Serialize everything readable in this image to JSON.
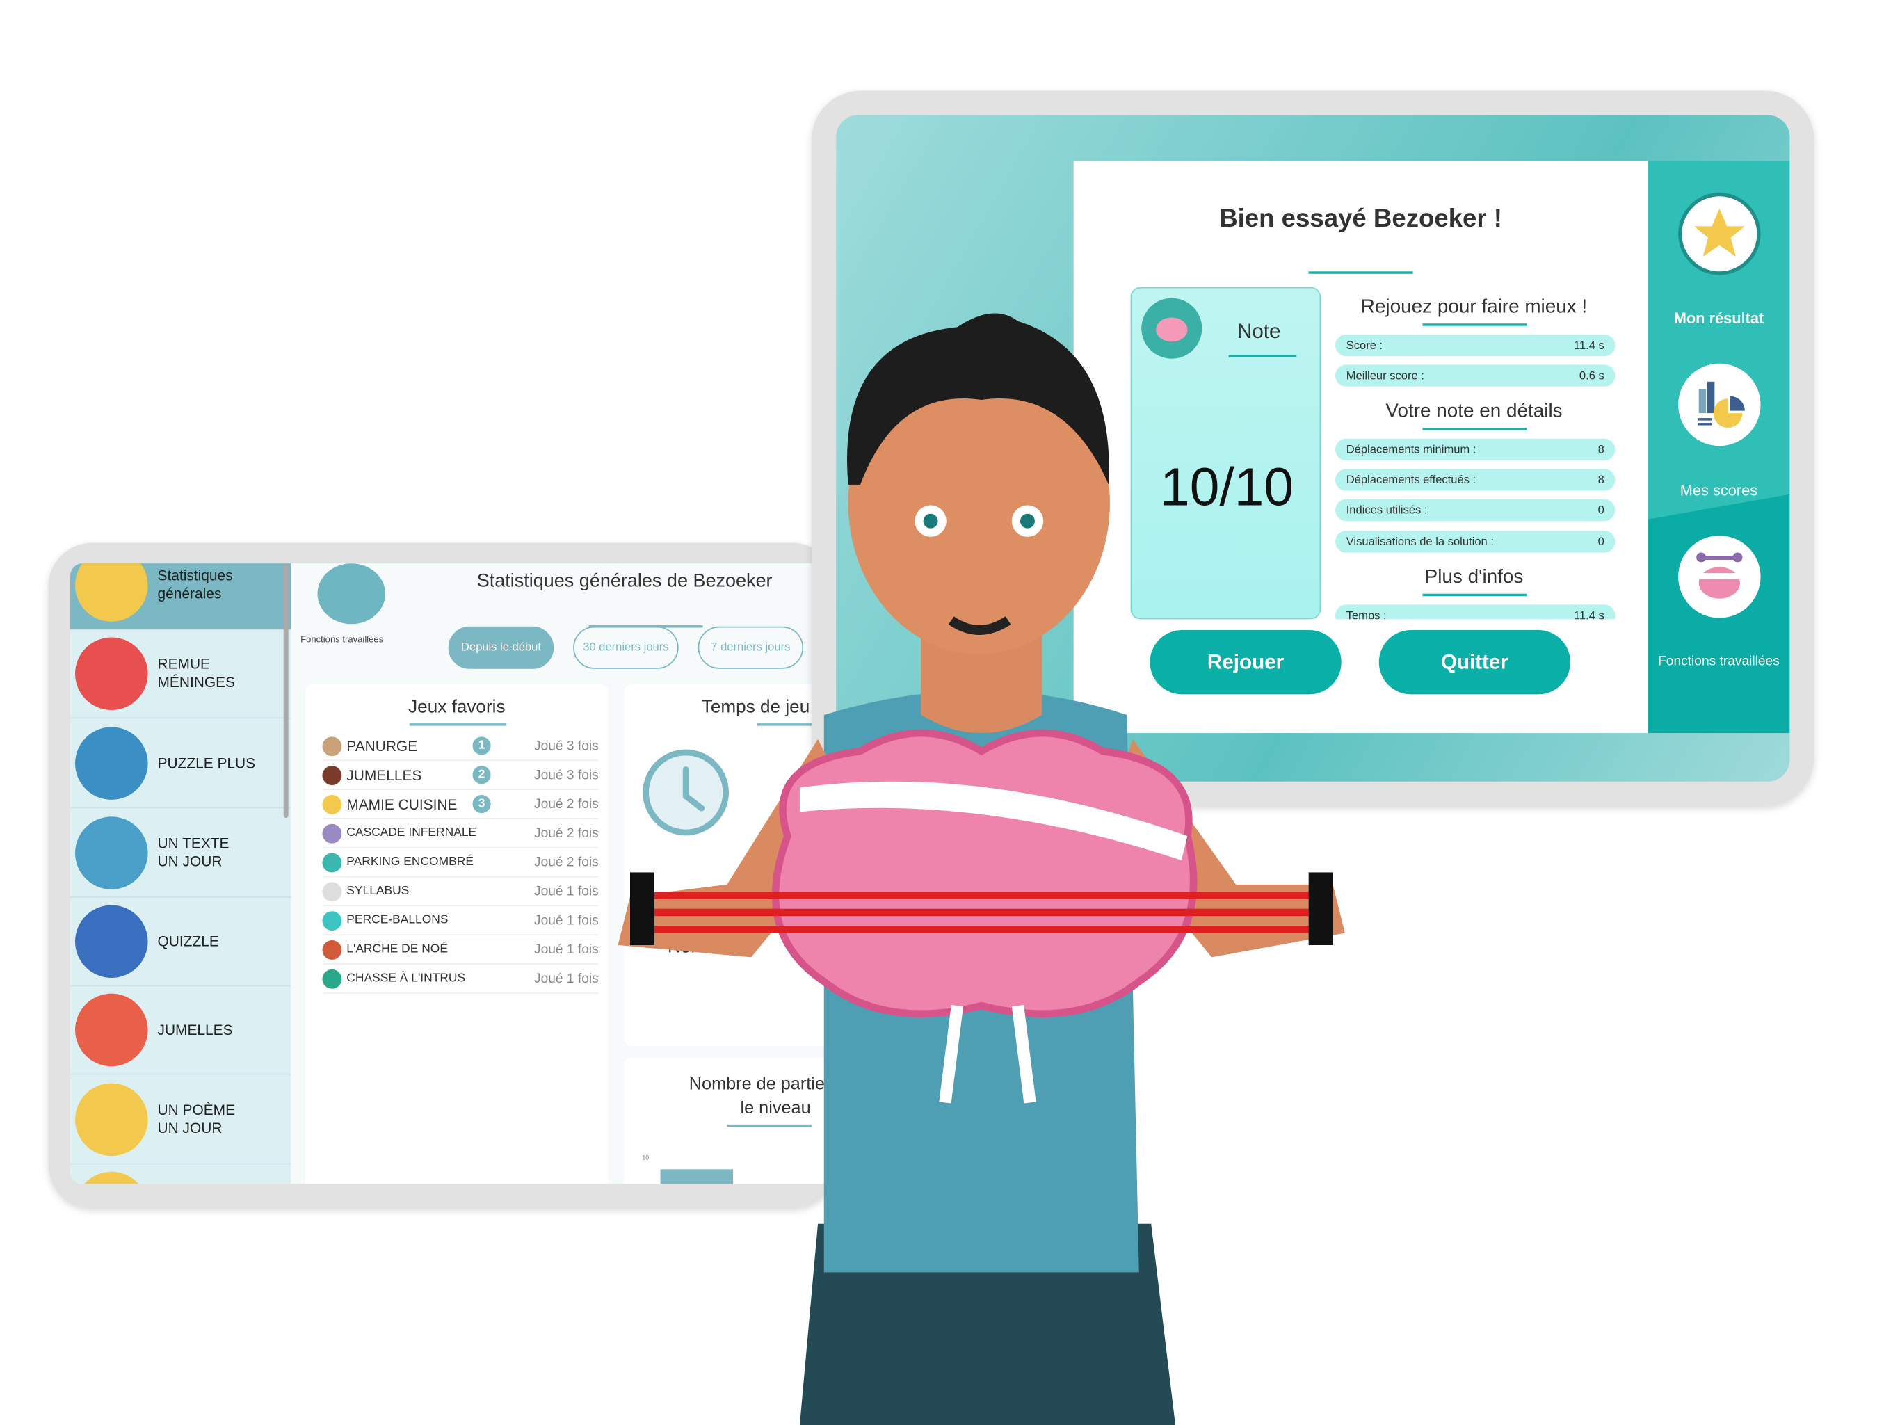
{
  "result_screen": {
    "title": "Bien essayé Bezoeker !",
    "note_card": {
      "label": "Note",
      "score": "10/10"
    },
    "sections": {
      "replay": "Rejouez pour faire mieux !",
      "details": "Votre note en détails",
      "more": "Plus d'infos"
    },
    "score_rows": [
      {
        "label": "Score :",
        "value": "11.4 s"
      },
      {
        "label": "Meilleur score :",
        "value": "0.6 s"
      }
    ],
    "detail_rows": [
      {
        "label": "Déplacements minimum :",
        "value": "8"
      },
      {
        "label": "Déplacements effectués :",
        "value": "8"
      },
      {
        "label": "Indices utilisés :",
        "value": "0"
      },
      {
        "label": "Visualisations de la solution :",
        "value": "0"
      }
    ],
    "more_rows": [
      {
        "label": "Temps :",
        "value": "11.4 s"
      }
    ],
    "buttons": {
      "replay": "Rejouer",
      "quit": "Quitter"
    },
    "sidebar": [
      {
        "label": "Mon résultat",
        "icon": "star-icon"
      },
      {
        "label": "Mes scores",
        "icon": "chart-icon"
      },
      {
        "label": "Fonctions travaillées",
        "icon": "brain-icon"
      }
    ],
    "colors": {
      "accent": "#0aafa8",
      "row_bg": "#b5f3ef",
      "star": "#f2c94c"
    }
  },
  "stats_screen": {
    "sidebar": [
      {
        "label": "Statistiques\ngénérales",
        "color": "#f2c94c"
      },
      {
        "label": "REMUE\nMÉNINGES",
        "color": "#e8504f"
      },
      {
        "label": "PUZZLE PLUS",
        "color": "#3b8fc4"
      },
      {
        "label": "UN TEXTE\nUN JOUR",
        "color": "#4aa0c9"
      },
      {
        "label": "QUIZZLE",
        "color": "#3a6fc0"
      },
      {
        "label": "JUMELLES",
        "color": "#e8604a"
      },
      {
        "label": "UN POÈME\nUN JOUR",
        "color": "#f2c94c"
      },
      {
        "label": "",
        "color": "#f2c94c"
      }
    ],
    "fonctions_label": "Fonctions travaillées",
    "title": "Statistiques générales de Bezoeker",
    "filters": [
      {
        "label": "Depuis le début",
        "active": true
      },
      {
        "label": "30 derniers jours",
        "active": false
      },
      {
        "label": "7 derniers jours",
        "active": false
      }
    ],
    "favorites": {
      "title": "Jeux favoris",
      "items": [
        {
          "name": "PANURGE",
          "rank": "1",
          "played": "Joué 3 fois",
          "color": "#c9a27a"
        },
        {
          "name": "JUMELLES",
          "rank": "2",
          "played": "Joué 3 fois",
          "color": "#7a3b2a"
        },
        {
          "name": "MAMIE CUISINE",
          "rank": "3",
          "played": "Joué 2 fois",
          "color": "#f2c94c"
        },
        {
          "name": "CASCADE INFERNALE",
          "rank": "",
          "played": "Joué 2 fois",
          "color": "#9a8ac4"
        },
        {
          "name": "PARKING ENCOMBRÉ",
          "rank": "",
          "played": "Joué 2 fois",
          "color": "#3bb7b0"
        },
        {
          "name": "SYLLABUS",
          "rank": "",
          "played": "Joué 1 fois",
          "color": "#ddd"
        },
        {
          "name": "PERCE-BALLONS",
          "rank": "",
          "played": "Joué 1 fois",
          "color": "#3bc4c0"
        },
        {
          "name": "L'ARCHE DE  NOÉ",
          "rank": "",
          "played": "Joué 1 fois",
          "color": "#d05a3a"
        },
        {
          "name": "CHASSE À L'INTRUS",
          "rank": "",
          "played": "Joué 1 fois",
          "color": "#2aa88a"
        }
      ]
    },
    "play_time": {
      "title": "Temps de jeu"
    },
    "games_count": {
      "title": "Nombre de"
    },
    "games_by_level": {
      "title": "Nombre de parties jou\nle niveau",
      "tick": "10"
    },
    "colors": {
      "accent": "#7cb8c4",
      "sidebar_bg": "#dcf0f3"
    }
  }
}
